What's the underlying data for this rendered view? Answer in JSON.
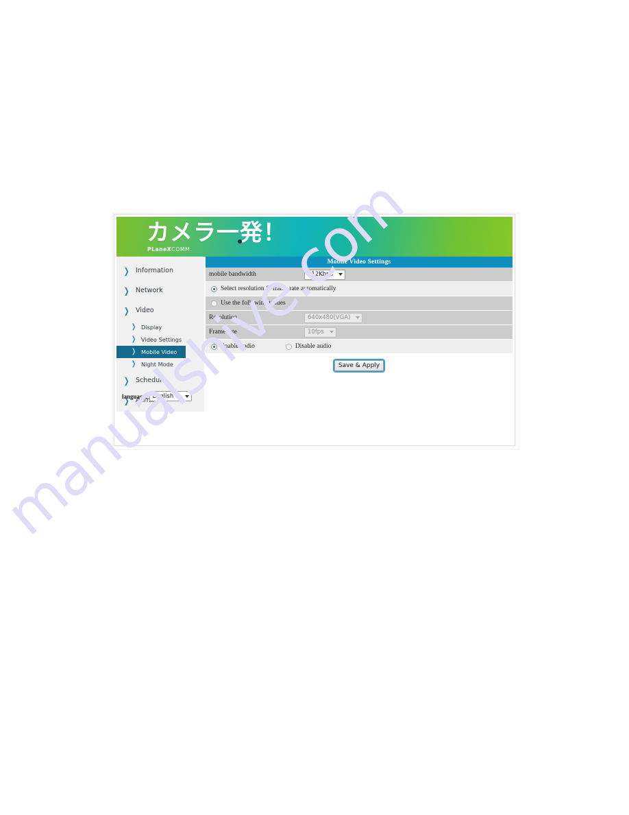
{
  "watermark": {
    "text": "manualshive.com"
  },
  "banner": {
    "logo_jp": "カメラ一発！",
    "brand_bold": "PLaneX",
    "brand_light": "COMM."
  },
  "sidebar": {
    "items": [
      {
        "label": "Information",
        "level": "top",
        "active": false
      },
      {
        "label": "Network",
        "level": "top",
        "active": false
      },
      {
        "label": "Video",
        "level": "top",
        "active": false
      },
      {
        "label": "Display",
        "level": "sub",
        "active": false
      },
      {
        "label": "Video Settings",
        "level": "sub",
        "active": false
      },
      {
        "label": "Mobile Video",
        "level": "sub",
        "active": true
      },
      {
        "label": "Night Mode",
        "level": "sub",
        "active": false
      },
      {
        "label": "Schedule",
        "level": "top",
        "active": false
      },
      {
        "label": "Admin",
        "level": "top",
        "active": false
      }
    ],
    "language": {
      "label": "language:",
      "value": "English"
    }
  },
  "panel": {
    "title": "Mobile Video Settings",
    "bandwidth": {
      "label": "mobile bandwidth",
      "value": "512Kbps"
    },
    "mode_auto": {
      "label": "Select resolution & frame rate automatically",
      "selected": true
    },
    "mode_manual": {
      "label": "Use the following values",
      "selected": false
    },
    "resolution": {
      "label": "Resolution",
      "value": "640x480(VGA)",
      "disabled": true
    },
    "framerate": {
      "label": "Frame rate",
      "value": "10fps",
      "disabled": true
    },
    "audio_enable": {
      "label": "Enable audio",
      "selected": true
    },
    "audio_disable": {
      "label": "Disable audio",
      "selected": false
    },
    "save_button": "Save & Apply"
  },
  "colors": {
    "panel_title_bg": "#0f8fbe",
    "active_nav_bg": "#146a8c",
    "chevron": "#1a7fb5",
    "row_dark": "#cccccc",
    "row_light": "#eeeeee",
    "watermark": "#dedcf6"
  }
}
